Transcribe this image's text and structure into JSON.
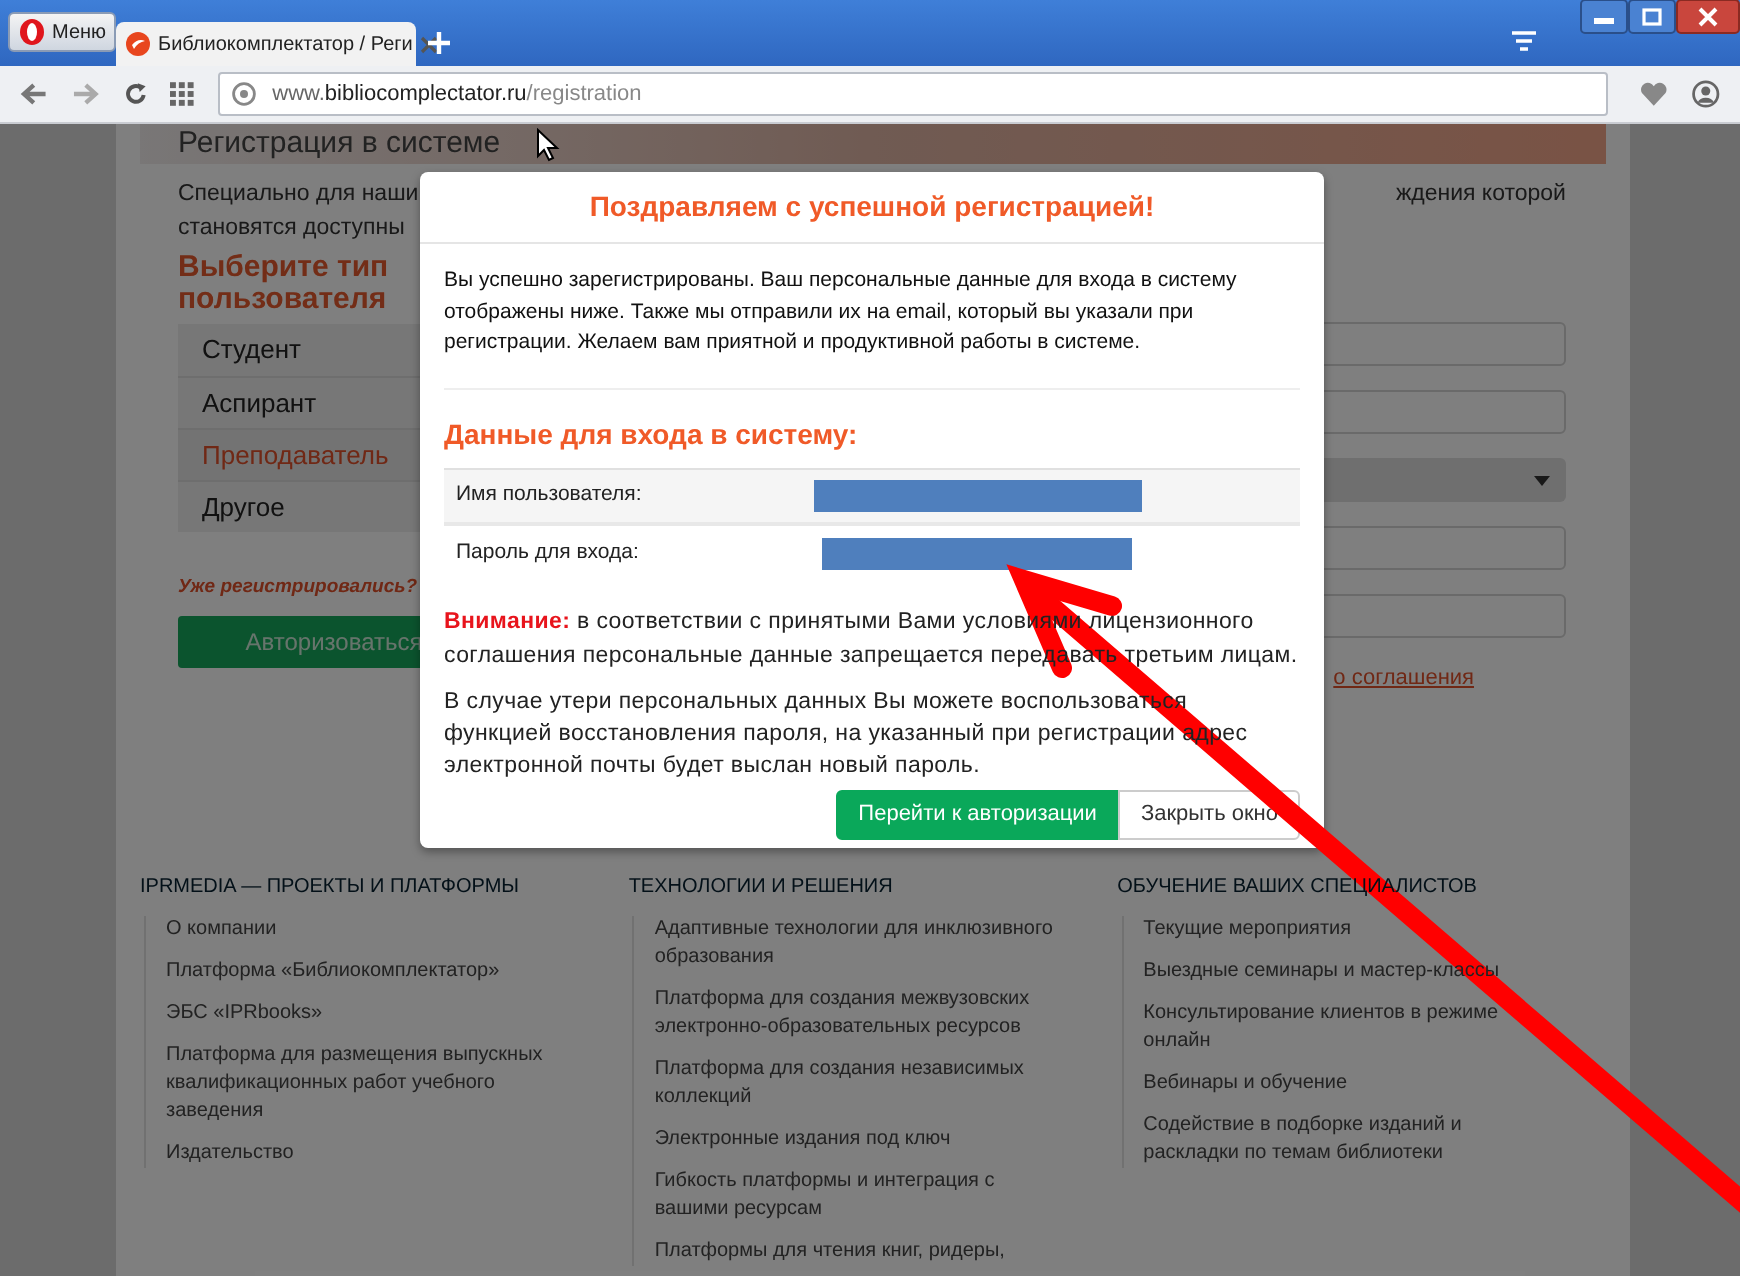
{
  "browser": {
    "menu_button": "Меню",
    "tab": {
      "title": "Библиокомплектатор / Реги",
      "selected": true
    },
    "url": {
      "host": "www.bibliocomplectator.ru",
      "path": "/registration"
    }
  },
  "page": {
    "heading": "Регистрация в системе",
    "intro_left": [
      "Специально для наши",
      "становятся доступны"
    ],
    "intro_right": "ждения которой",
    "user_type_title": "Выберите тип пользователя",
    "user_types": [
      {
        "label": "Студент",
        "selected": false
      },
      {
        "label": "Аспирант",
        "selected": false
      },
      {
        "label": "Преподаватель",
        "selected": true
      },
      {
        "label": "Другое",
        "selected": false
      }
    ],
    "form_fields": [
      {
        "kind": "input"
      },
      {
        "kind": "input"
      },
      {
        "kind": "select"
      },
      {
        "kind": "input"
      },
      {
        "kind": "input"
      }
    ],
    "login_prompt": "Уже регистрировались?",
    "login_button": "Авторизоваться",
    "agreement_link": "о соглашения"
  },
  "modal": {
    "title": "Поздравляем с успешной регистрацией!",
    "message": "Вы успешно зарегистрированы. Ваш персональные данные для входа в систему отображены ниже. Также мы отправили их на email, который вы указали при регистрации. Желаем вам приятной и продуктивной работы в системе.",
    "credentials_title": "Данные для входа в систему:",
    "credentials": [
      {
        "label": "Имя пользователя:"
      },
      {
        "label": "Пароль для входа:"
      }
    ],
    "warning": "**Внимание:** в соответствии с принятыми Вами условиями лицензионного соглашения персональные данные запрещается передавать третьим лицам.",
    "recovery_note": "В случае утери персональных данных Вы можете воспользоваться функцией восстановления пароля, на указанный при регистрации адрес электронной почты будет выслан новый пароль.",
    "buttons": [
      {
        "label": "Перейти к авторизации",
        "kind": "primary"
      },
      {
        "label": "Закрыть окно",
        "kind": "secondary"
      }
    ]
  },
  "footer": {
    "columns": [
      {
        "title": "IPRMEDIA — ПРОЕКТЫ И ПЛАТФОРМЫ",
        "links": [
          "О компании",
          "Платформа «Библиокомплектатор»",
          "ЭБС «IPRbooks»",
          "Платформа для размещения выпускных квалификационных работ учебного заведения",
          "Издательство"
        ]
      },
      {
        "title": "ТЕХНОЛОГИИ И РЕШЕНИЯ",
        "links": [
          "Адаптивные технологии для инклюзивного образования",
          "Платформа для создания межвузовских электронно-образовательных ресурсов",
          "Платформа для создания независимых коллекций",
          "Электронные издания под ключ",
          "Гибкость платформы и интеграция с вашими ресурсам",
          "Платформы для чтения книг, ридеры,"
        ]
      },
      {
        "title": "ОБУЧЕНИЕ ВАШИХ СПЕЦИАЛИСТОВ",
        "links": [
          "Текущие мероприятия",
          "Выездные семинары и мастер-классы",
          "Консультирование клиентов в режиме онлайн",
          "Вебинары и обучение",
          "Содействие в подборке изданий и раскладки по темам библиотеки"
        ]
      }
    ]
  }
}
